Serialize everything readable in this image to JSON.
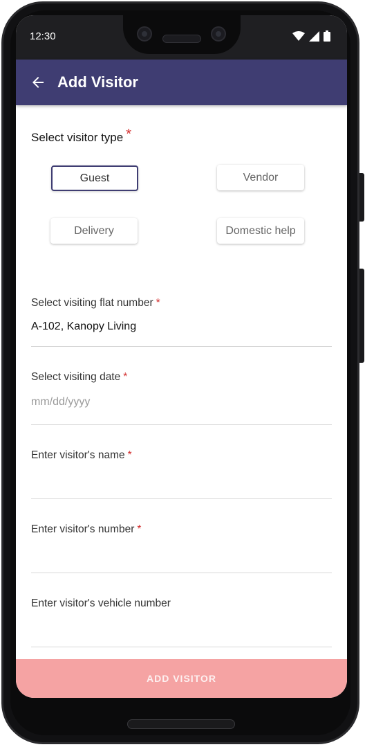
{
  "status_bar": {
    "time": "12:30"
  },
  "app_bar": {
    "title": "Add Visitor"
  },
  "visitor_type": {
    "label": "Select visitor type",
    "required_mark": "*",
    "options": [
      "Guest",
      "Vendor",
      "Delivery",
      "Domestic help"
    ],
    "selected": "Guest"
  },
  "fields": {
    "flat": {
      "label": "Select visiting flat number",
      "required_mark": "*",
      "value": "A-102, Kanopy Living"
    },
    "date": {
      "label": "Select visiting date",
      "required_mark": "*",
      "placeholder": "mm/dd/yyyy"
    },
    "name": {
      "label": "Enter visitor's name",
      "required_mark": "*",
      "value": ""
    },
    "number": {
      "label": "Enter visitor's number",
      "required_mark": "*",
      "value": ""
    },
    "vehicle": {
      "label": "Enter visitor's vehicle number",
      "value": ""
    }
  },
  "submit": {
    "label": "ADD VISITOR"
  },
  "colors": {
    "primary": "#3f3d72",
    "submit_disabled": "#f5a3a3",
    "required": "#d32f2f"
  }
}
